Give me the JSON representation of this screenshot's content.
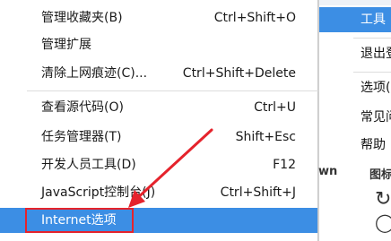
{
  "parent_menu": {
    "items": [
      {
        "label": "工具",
        "active": true
      },
      {
        "label": "退出登录",
        "active": false
      },
      {
        "label": "选项(O)",
        "active": false
      },
      {
        "label": "常见问题",
        "active": false
      },
      {
        "label": "帮助",
        "active": false
      }
    ]
  },
  "background": {
    "fragment_wn": "wn",
    "fragment_title": "图标",
    "refresh_icon": "refresh-icon"
  },
  "menu": {
    "items": [
      {
        "label": "管理收藏夹(B)",
        "shortcut": "Ctrl+Shift+O"
      },
      {
        "label": "管理扩展",
        "shortcut": ""
      },
      {
        "label": "清除上网痕迹(C)...",
        "shortcut": "Ctrl+Shift+Delete"
      },
      {
        "label": "查看源代码(O)",
        "shortcut": "Ctrl+U"
      },
      {
        "label": "任务管理器(T)",
        "shortcut": "Shift+Esc"
      },
      {
        "label": "开发人员工具(D)",
        "shortcut": "F12"
      },
      {
        "label": "JavaScript控制台(J)",
        "shortcut": "Ctrl+Shift+J"
      },
      {
        "label": "Internet选项",
        "shortcut": ""
      }
    ]
  },
  "colors": {
    "highlight": "#3c8ee4",
    "annotation_red": "#e5232c"
  }
}
